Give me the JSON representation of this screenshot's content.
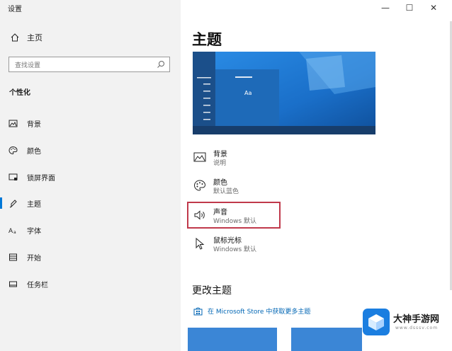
{
  "window": {
    "title": "设置",
    "controls": {
      "minimize": "—",
      "maximize": "☐",
      "close": "✕"
    }
  },
  "sidebar": {
    "home_label": "主页",
    "search_placeholder": "查找设置",
    "section_title": "个性化",
    "items": [
      {
        "label": "背景",
        "icon": "picture-icon"
      },
      {
        "label": "颜色",
        "icon": "palette-icon"
      },
      {
        "label": "锁屏界面",
        "icon": "lock-screen-icon"
      },
      {
        "label": "主题",
        "icon": "theme-icon",
        "active": true
      },
      {
        "label": "字体",
        "icon": "font-icon"
      },
      {
        "label": "开始",
        "icon": "start-icon"
      },
      {
        "label": "任务栏",
        "icon": "taskbar-icon"
      }
    ]
  },
  "main": {
    "title": "主题",
    "preview_sample_text": "Aa",
    "settings": [
      {
        "name": "背景",
        "value": "说明",
        "icon": "picture-icon"
      },
      {
        "name": "颜色",
        "value": "默认蓝色",
        "icon": "palette-icon"
      },
      {
        "name": "声音",
        "value": "Windows 默认",
        "icon": "speaker-icon"
      },
      {
        "name": "鼠标光标",
        "value": "Windows 默认",
        "icon": "cursor-icon"
      }
    ],
    "change_theme_title": "更改主题",
    "store_link": "在 Microsoft Store 中获取更多主题"
  },
  "watermark": {
    "text": "大神手游网",
    "sub": "www.dsssv.com"
  },
  "colors": {
    "accent": "#0078d7",
    "highlight_border": "#c0394b",
    "sidebar_bg": "#f2f2f2"
  }
}
